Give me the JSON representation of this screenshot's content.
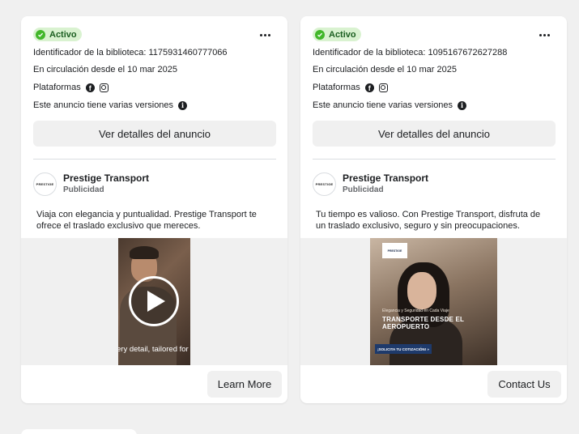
{
  "cards": [
    {
      "status": "Activo",
      "library_id": "Identificador de la biblioteca: 1175931460777066",
      "circulation": "En circulación desde el 10 mar 2025",
      "platforms_label": "Plataformas",
      "versions_note": "Este anuncio tiene varias versiones",
      "details_button": "Ver detalles del anuncio",
      "advertiser": "Prestige Transport",
      "advertiser_sub": "Publicidad",
      "avatar_text": "PRESTIGE",
      "body": "Viaja con elegancia y puntualidad. Prestige Transport te ofrece el traslado exclusivo que mereces.",
      "media_caption": "ery detail, tailored for y",
      "cta": "Learn More"
    },
    {
      "status": "Activo",
      "library_id": "Identificador de la biblioteca: 1095167672627288",
      "circulation": "En circulación desde el 10 mar 2025",
      "platforms_label": "Plataformas",
      "versions_note": "Este anuncio tiene varias versiones",
      "details_button": "Ver detalles del anuncio",
      "advertiser": "Prestige Transport",
      "advertiser_sub": "Publicidad",
      "avatar_text": "PRESTIGE",
      "body": "Tu tiempo es valioso. Con Prestige Transport, disfruta de un traslado exclusivo, seguro y sin preocupaciones.",
      "media_logo": "PRESTIGE",
      "media_small": "Elegancia y Seguridad en Cada Viaje",
      "media_title": "TRANSPORTE DESDE EL AEROPUERTO",
      "media_cta": "¡SOLICITA TU COTIZACIÓN! »",
      "cta": "Contact Us"
    }
  ],
  "icons": {
    "status": "check-circle-icon",
    "more": "more-horizontal-icon",
    "facebook": "facebook-icon",
    "instagram": "instagram-icon",
    "info": "info-icon",
    "play": "play-icon"
  },
  "colors": {
    "page_bg": "#f0f0f0",
    "card_bg": "#ffffff",
    "badge_bg": "#d9f2d0",
    "badge_check": "#42b72a",
    "button_bg": "#f0f0f0"
  }
}
